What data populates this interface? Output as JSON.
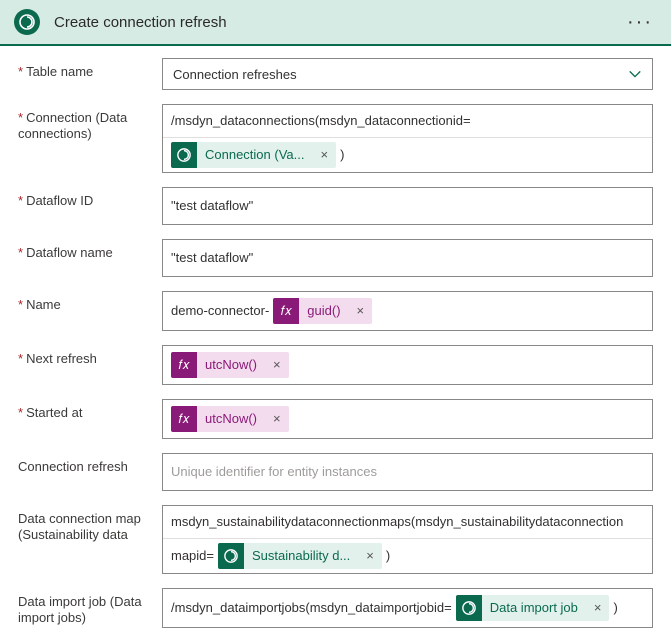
{
  "header": {
    "title": "Create connection refresh"
  },
  "labels": {
    "table_name": "Table name",
    "connection": "Connection (Data connections)",
    "dataflow_id": "Dataflow ID",
    "dataflow_name": "Dataflow name",
    "name": "Name",
    "next_refresh": "Next refresh",
    "started_at": "Started at",
    "connection_refresh": "Connection refresh",
    "data_connection_map": "Data connection map (Sustainability data",
    "data_import_job": "Data import job (Data import jobs)"
  },
  "values": {
    "table_name": "Connection refreshes",
    "dataflow_id": "\"test dataflow\"",
    "dataflow_name": "\"test dataflow\"",
    "name_prefix": "demo-connector-",
    "connection_line1": "/msdyn_dataconnections(msdyn_dataconnectionid=",
    "connection_token": "Connection (Va...",
    "connection_suffix": ")",
    "guid_token": "guid()",
    "utcnow_token": "utcNow()",
    "placeholder_cr": "Unique identifier for entity instances",
    "map_line1": "msdyn_sustainabilitydataconnectionmaps(msdyn_sustainabilitydataconnection",
    "map_line2_prefix": "mapid=",
    "map_token": "Sustainability d...",
    "map_suffix": ")",
    "import_prefix": "/msdyn_dataimportjobs(msdyn_dataimportjobid=",
    "import_token": "Data import job",
    "import_suffix": ")",
    "fx_label": "𝑓𝑥"
  }
}
